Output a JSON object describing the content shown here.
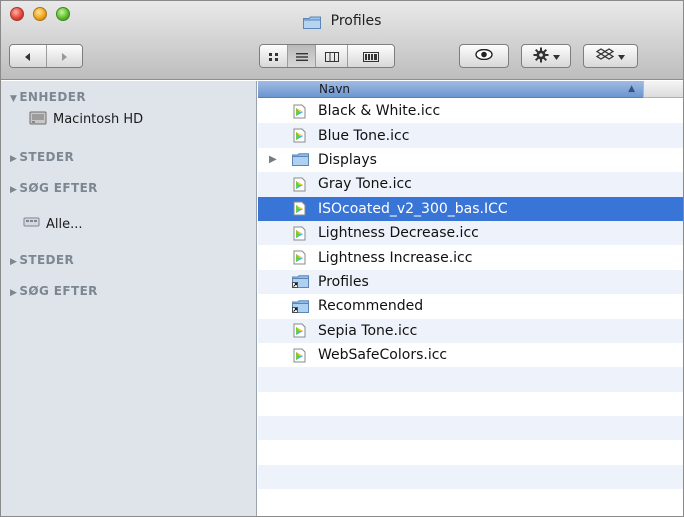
{
  "window": {
    "title": "Profiles"
  },
  "toolbar": {
    "nav": {
      "back_icon": "back-arrow-icon",
      "forward_icon": "forward-arrow-icon"
    },
    "views": [
      {
        "name": "view-icon-mode",
        "icon": "icon-view-icon",
        "active": false
      },
      {
        "name": "view-list-mode",
        "icon": "list-view-icon",
        "active": true
      },
      {
        "name": "view-column-mode",
        "icon": "column-view-icon",
        "active": false
      },
      {
        "name": "view-coverflow-mode",
        "icon": "coverflow-view-icon",
        "active": false
      }
    ],
    "quicklook_icon": "eye-icon",
    "action_icon": "gear-icon",
    "dropbox_icon": "dropbox-icon"
  },
  "sidebar": {
    "sections": [
      {
        "label": "ENHEDER",
        "expanded": true
      },
      {
        "label": "STEDER",
        "expanded": false
      },
      {
        "label": "SØG EFTER",
        "expanded": false
      },
      {
        "label": "STEDER",
        "expanded": false
      },
      {
        "label": "SØG EFTER",
        "expanded": false
      }
    ],
    "items": [
      {
        "label": "Macintosh HD",
        "icon": "hard-drive-icon"
      },
      {
        "label": "Alle...",
        "icon": "network-icon"
      }
    ]
  },
  "list": {
    "column_header": "Navn",
    "sort_indicator": "▲",
    "rows": [
      {
        "name": "Black & White.icc",
        "type": "icc"
      },
      {
        "name": "Blue Tone.icc",
        "type": "icc"
      },
      {
        "name": "Displays",
        "type": "folder",
        "disclosure": "▶"
      },
      {
        "name": "Gray Tone.icc",
        "type": "icc"
      },
      {
        "name": "ISOcoated_v2_300_bas.ICC",
        "type": "icc",
        "selected": true
      },
      {
        "name": "Lightness Decrease.icc",
        "type": "icc"
      },
      {
        "name": "Lightness Increase.icc",
        "type": "icc"
      },
      {
        "name": "Profiles",
        "type": "alias-folder"
      },
      {
        "name": "Recommended",
        "type": "alias-folder"
      },
      {
        "name": "Sepia Tone.icc",
        "type": "icc"
      },
      {
        "name": "WebSafeColors.icc",
        "type": "icc"
      }
    ]
  },
  "colors": {
    "selection": "#3875d7",
    "sidebar_bg": "#dfe4eb",
    "stripe": "#eef3fb"
  }
}
